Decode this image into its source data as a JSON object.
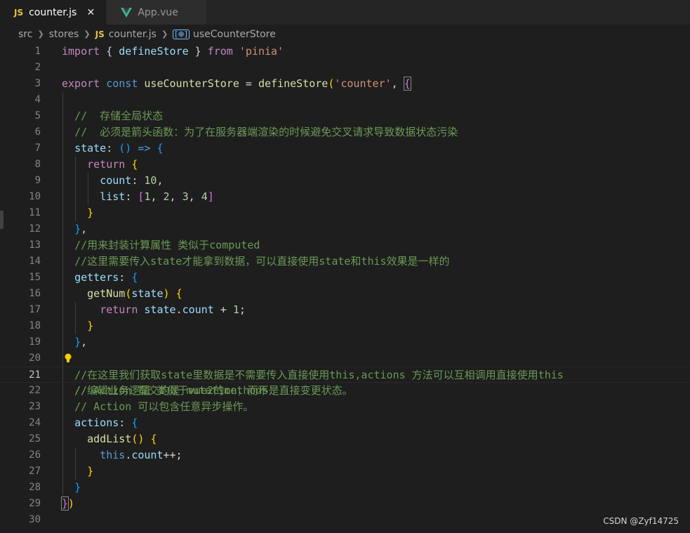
{
  "tabs": [
    {
      "badge": "JS",
      "label": "counter.js",
      "close": "✕"
    },
    {
      "label": "App.vue"
    }
  ],
  "breadcrumb": {
    "parts": [
      "src",
      "stores"
    ],
    "file_badge": "JS",
    "file": "counter.js",
    "symbol_icon": "[⊕]",
    "symbol": "useCounterStore"
  },
  "editor": {
    "current_line": 21,
    "lines": [
      {
        "n": "1"
      },
      {
        "n": "2"
      },
      {
        "n": "3"
      },
      {
        "n": "4"
      },
      {
        "n": "5"
      },
      {
        "n": "6"
      },
      {
        "n": "7"
      },
      {
        "n": "8"
      },
      {
        "n": "9"
      },
      {
        "n": "10"
      },
      {
        "n": "11"
      },
      {
        "n": "12"
      },
      {
        "n": "13"
      },
      {
        "n": "14"
      },
      {
        "n": "15"
      },
      {
        "n": "16"
      },
      {
        "n": "17"
      },
      {
        "n": "18"
      },
      {
        "n": "19"
      },
      {
        "n": "20"
      },
      {
        "n": "21"
      },
      {
        "n": "22"
      },
      {
        "n": "23"
      },
      {
        "n": "24"
      },
      {
        "n": "25"
      },
      {
        "n": "26"
      },
      {
        "n": "27"
      },
      {
        "n": "28"
      },
      {
        "n": "29"
      },
      {
        "n": "30"
      }
    ],
    "code": {
      "l1_import": "import",
      "l1_brace_open": "{",
      "l1_name": "defineStore",
      "l1_brace_close": "}",
      "l1_from": "from",
      "l1_str": "'pinia'",
      "l3_export": "export",
      "l3_const": "const",
      "l3_name": "useCounterStore",
      "l3_eq": "=",
      "l3_fn": "defineStore",
      "l3_paren": "(",
      "l3_str": "'counter'",
      "l3_comma": ",",
      "l3_brace": "{",
      "l5_comment": "//  存储全局状态",
      "l6_comment": "//  必须是箭头函数：为了在服务器端渲染的时候避免交叉请求导致数据状态污染",
      "l7_state": "state",
      "l7_colon": ":",
      "l7_parens": "()",
      "l7_arrow": "=>",
      "l7_brace": "{",
      "l8_return": "return",
      "l8_brace": "{",
      "l9_count": "count",
      "l9_rest": ": ",
      "l9_num": "10",
      "l9_comma": ",",
      "l10_list": "list",
      "l10_colon": ": ",
      "l10_open": "[",
      "l10_n1": "1",
      "l10_n2": "2",
      "l10_n3": "3",
      "l10_n4": "4",
      "l10_sep": ", ",
      "l10_close": "]",
      "l11_brace": "}",
      "l12_brace": "}",
      "l12_comma": ",",
      "l13_comment": "//用来封装计算属性 类似于computed",
      "l14_comment": "//这里需要传入state才能拿到数据，可以直接使用state和this效果是一样的",
      "l15_getters": "getters",
      "l15_colon": ":",
      "l15_brace": "{",
      "l16_fn": "getNum",
      "l16_open": "(",
      "l16_param": "state",
      "l16_close": ")",
      "l16_brace": "{",
      "l17_return": "return",
      "l17_state": "state",
      "l17_dot": ".",
      "l17_count": "count",
      "l17_plus": "+",
      "l17_num": "1",
      "l17_semi": ";",
      "l18_brace": "}",
      "l19_brace": "}",
      "l19_comma": ",",
      "l20_comment": "//编辑业务逻辑 类似于vue2的methods",
      "l21_comment": "//在这里我们获取state里数据是不需要传入直接使用this,actions 方法可以互相调用直接使用this",
      "l22_comment": "// Action 提交的是 mutation，而不是直接变更状态。",
      "l23_comment": "// Action 可以包含任意异步操作。",
      "l24_actions": "actions",
      "l24_colon": ":",
      "l24_brace": "{",
      "l25_fn": "addList",
      "l25_parens": "()",
      "l25_brace": "{",
      "l26_this": "this",
      "l26_dot": ".",
      "l26_count": "count",
      "l26_inc": "++;",
      "l27_brace": "}",
      "l28_brace": "}",
      "l29_brace": "}",
      "l29_paren": ")"
    }
  },
  "watermark": "CSDN @Zyf14725",
  "colors": {
    "background": "#1e1e1e",
    "keyword": "#569cd6",
    "control_keyword": "#c586c0",
    "function": "#dcdcaa",
    "variable": "#9cdcfe",
    "number": "#b5cea8",
    "string": "#ce9178",
    "comment": "#6a9955",
    "js_badge": "#e8c33f",
    "vue_green": "#41b883"
  }
}
